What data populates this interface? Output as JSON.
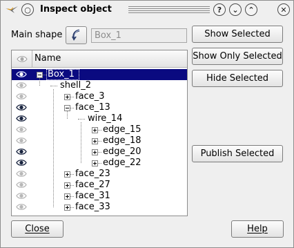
{
  "window": {
    "title": "Inspect object",
    "buttons": {
      "menu": "○",
      "help": "?",
      "minimize": "⌄",
      "maximize": "⌃",
      "close": "✕"
    }
  },
  "main_shape": {
    "label": "Main shape",
    "value": "Box_1"
  },
  "actions": {
    "show_selected": "Show Selected",
    "show_only_selected": "Show Only Selected",
    "hide_selected": "Hide Selected",
    "publish_selected": "Publish Selected"
  },
  "tree": {
    "columns": {
      "name": "Name"
    },
    "rows": [
      {
        "label": "Box_1",
        "depth": 0,
        "expander": "minus",
        "visible": "partial",
        "selected": true
      },
      {
        "label": "shell_2",
        "depth": 1,
        "expander": "none",
        "visible": "hidden"
      },
      {
        "label": "face_3",
        "depth": 2,
        "expander": "plus",
        "visible": "hidden"
      },
      {
        "label": "face_13",
        "depth": 2,
        "expander": "minus",
        "visible": "shown"
      },
      {
        "label": "wire_14",
        "depth": 3,
        "expander": "none",
        "visible": "shown"
      },
      {
        "label": "edge_15",
        "depth": 4,
        "expander": "plus",
        "visible": "hidden"
      },
      {
        "label": "edge_18",
        "depth": 4,
        "expander": "plus",
        "visible": "hidden"
      },
      {
        "label": "edge_20",
        "depth": 4,
        "expander": "plus",
        "visible": "shown"
      },
      {
        "label": "edge_22",
        "depth": 4,
        "expander": "plus",
        "visible": "shown"
      },
      {
        "label": "face_23",
        "depth": 2,
        "expander": "plus",
        "visible": "hidden"
      },
      {
        "label": "face_27",
        "depth": 2,
        "expander": "plus",
        "visible": "hidden"
      },
      {
        "label": "face_31",
        "depth": 2,
        "expander": "plus",
        "visible": "hidden"
      },
      {
        "label": "face_33",
        "depth": 2,
        "expander": "plus",
        "visible": "hidden"
      }
    ]
  },
  "footer": {
    "close": "Close",
    "help": "Help"
  },
  "icons": {
    "window_logo": "salome-logo-icon",
    "select_shape": "arrow-select-icon",
    "visibility": "eye-icon"
  },
  "colors": {
    "selection": "#0a0a80",
    "eye_shown": "#1a2540",
    "eye_hidden": "#b8b8b8"
  }
}
